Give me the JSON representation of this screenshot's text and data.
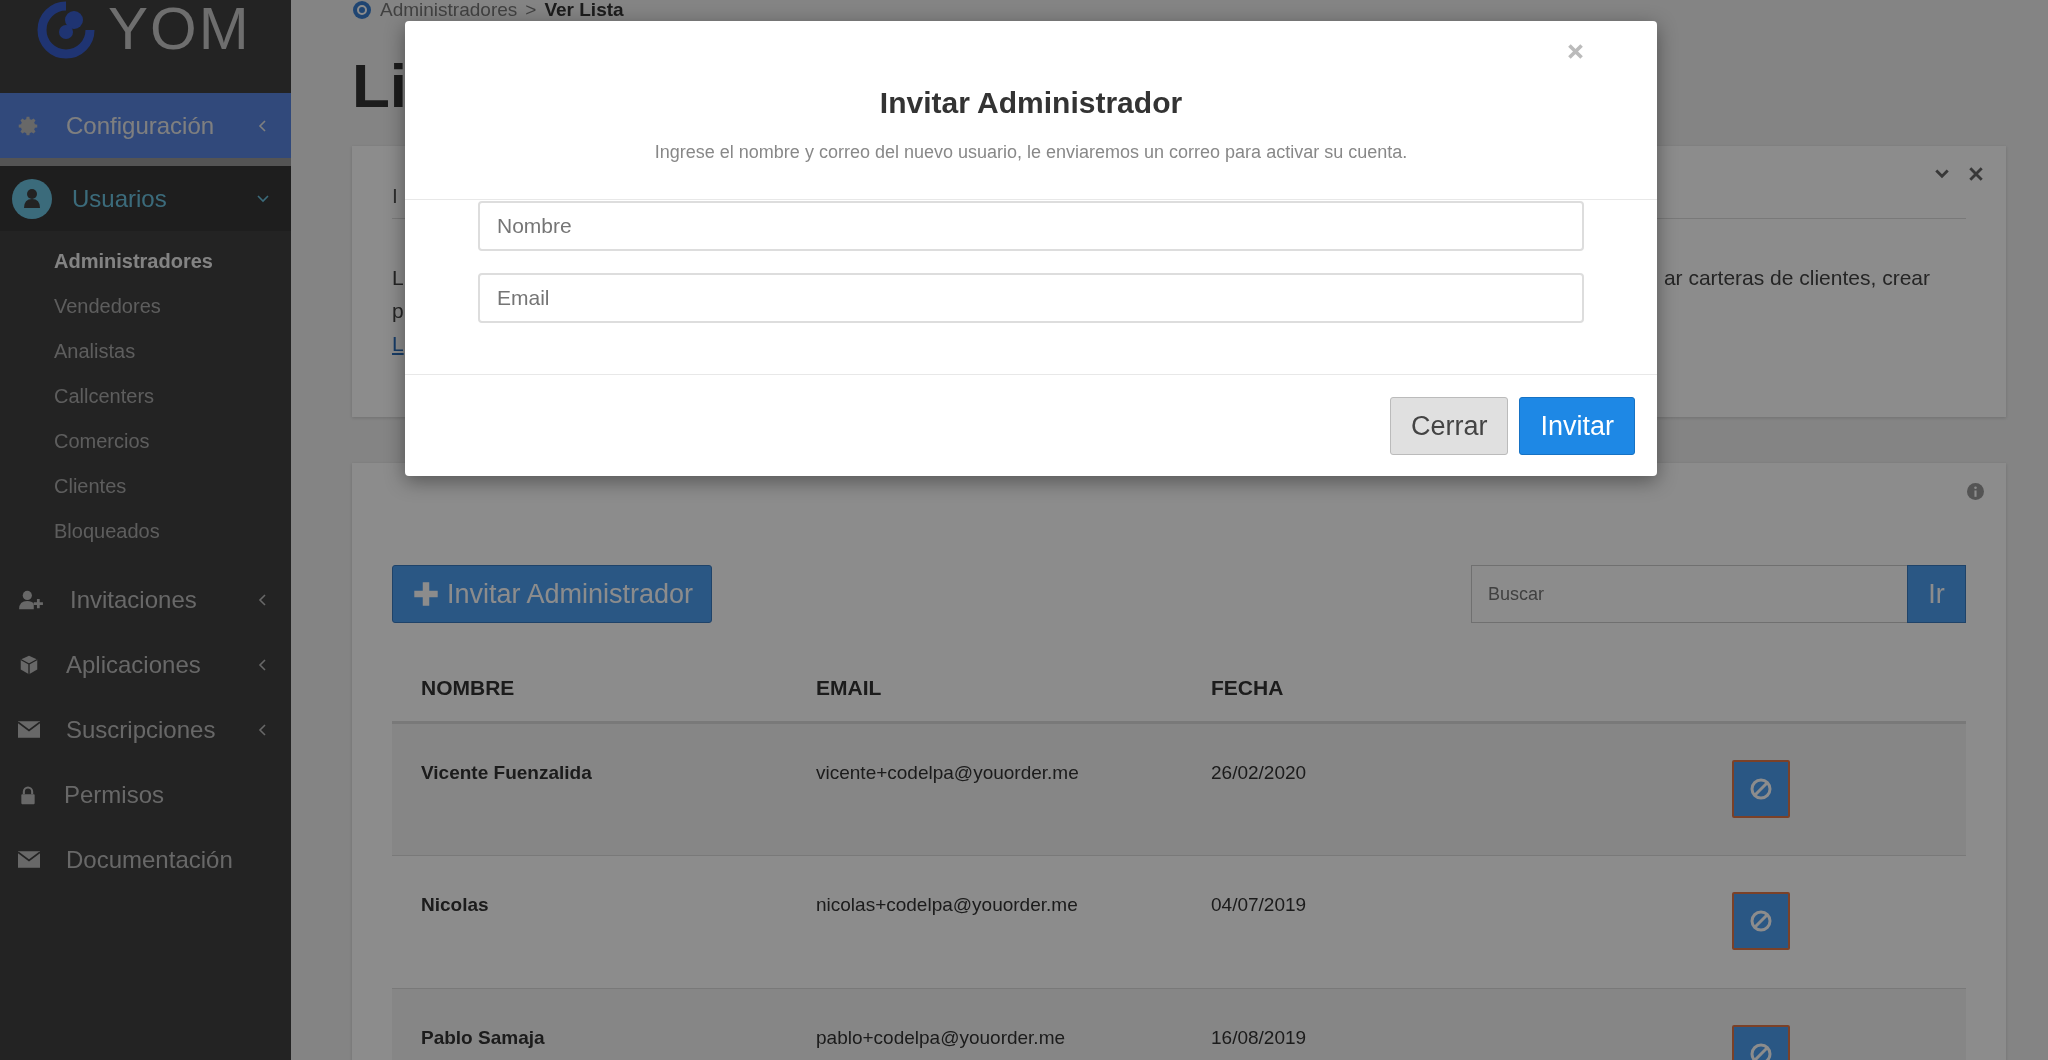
{
  "logo": {
    "text": "YOM"
  },
  "sidebar": {
    "items": [
      {
        "label": "Configuración",
        "kind": "group",
        "selected": true,
        "expanded": false
      },
      {
        "label": "Usuarios",
        "kind": "group",
        "selected": false,
        "expanded": true,
        "children": [
          {
            "label": "Administradores",
            "selected": true
          },
          {
            "label": "Vendedores",
            "selected": false
          },
          {
            "label": "Analistas",
            "selected": false
          },
          {
            "label": "Callcenters",
            "selected": false
          },
          {
            "label": "Comercios",
            "selected": false
          },
          {
            "label": "Clientes",
            "selected": false
          },
          {
            "label": "Bloqueados",
            "selected": false
          }
        ]
      },
      {
        "label": "Invitaciones",
        "kind": "group",
        "selected": false,
        "expanded": false
      },
      {
        "label": "Aplicaciones",
        "kind": "group",
        "selected": false,
        "expanded": false
      },
      {
        "label": "Suscripciones",
        "kind": "group",
        "selected": false,
        "expanded": false
      },
      {
        "label": "Permisos",
        "kind": "link",
        "selected": false
      },
      {
        "label": "Documentación",
        "kind": "link",
        "selected": false
      }
    ]
  },
  "breadcrumb": {
    "items": [
      "Administradores",
      ">",
      "Ver Lista"
    ]
  },
  "page_title": "Li",
  "info_panel": {
    "title": "I",
    "line_1_start": "L",
    "line_1_end": "ar carteras de clientes, crear",
    "line_2": "p",
    "link": "L"
  },
  "list_panel": {
    "invite_button": "Invitar Administrador",
    "search": {
      "placeholder": "Buscar"
    },
    "search_button": "Ir",
    "table": {
      "columns": [
        "NOMBRE",
        "EMAIL",
        "FECHA"
      ],
      "rows": [
        {
          "name": "Vicente Fuenzalida",
          "email": "vicente+codelpa@youorder.me",
          "date": "26/02/2020"
        },
        {
          "name": "Nicolas",
          "email": "nicolas+codelpa@youorder.me",
          "date": "04/07/2019"
        },
        {
          "name": "Pablo Samaja",
          "email": "pablo+codelpa@youorder.me",
          "date": "16/08/2019"
        }
      ]
    }
  },
  "modal": {
    "title": "Invitar Administrador",
    "subtitle": "Ingrese el nombre y correo del nuevo usuario, le enviaremos un correo para activar su cuenta.",
    "fields": [
      {
        "placeholder": "Nombre"
      },
      {
        "placeholder": "Email"
      }
    ],
    "buttons": [
      {
        "label": "Cerrar",
        "kind": "secondary"
      },
      {
        "label": "Invitar",
        "kind": "primary"
      }
    ]
  }
}
